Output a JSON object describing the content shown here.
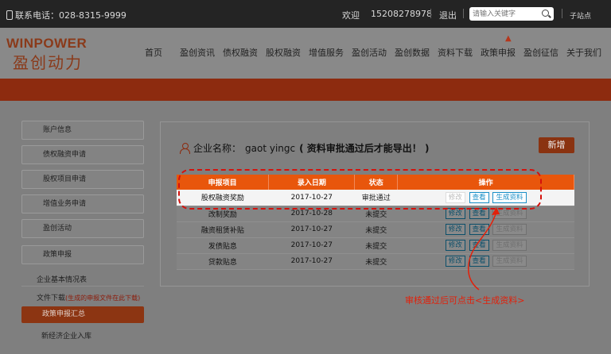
{
  "topbar": {
    "phone": "联系电话：028-8315-9999",
    "welcome": "欢迎",
    "user": "15208278978",
    "logout": "退出",
    "search_placeholder": "请输入关键字",
    "substation": "子站点"
  },
  "logo": {
    "en": "WINPOWER",
    "cn": "盈创动力"
  },
  "nav": [
    "首页",
    "盈创资讯",
    "债权融资",
    "股权融资",
    "增值服务",
    "盈创活动",
    "盈创数据",
    "资料下载",
    "政策申报",
    "盈创征信",
    "关于我们"
  ],
  "sidebar": {
    "items": [
      "账户信息",
      "债权融资申请",
      "股权项目申请",
      "增值业务申请",
      "盈创活动",
      "政策申报"
    ],
    "sub_items": [
      "企业基本情况表",
      "文件下载"
    ],
    "download_note": "(生成的申报文件在此下载)",
    "active": "政策申报汇总",
    "last": "新经济企业入库"
  },
  "main": {
    "company_label": "企业名称：",
    "company_name": "gaot yingc",
    "company_note": "( 资料审批通过后才能导出！ )",
    "add_button": "新增",
    "table": {
      "headers": [
        "申报项目",
        "录入日期",
        "状态",
        "操作"
      ],
      "rows": [
        {
          "project": "股权融资奖励",
          "date": "2017-10-27",
          "status": "审批通过"
        },
        {
          "project": "改制奖励",
          "date": "2017-10-28",
          "status": "未提交"
        },
        {
          "project": "融资租赁补贴",
          "date": "2017-10-27",
          "status": "未提交"
        },
        {
          "project": "发债贴息",
          "date": "2017-10-27",
          "status": "未提交"
        },
        {
          "project": "贷款贴息",
          "date": "2017-10-27",
          "status": "未提交"
        }
      ],
      "actions": {
        "edit": "修改",
        "view": "查看",
        "generate": "生成资料"
      }
    },
    "annotation": "审核通过后可点击<生成资料>"
  }
}
